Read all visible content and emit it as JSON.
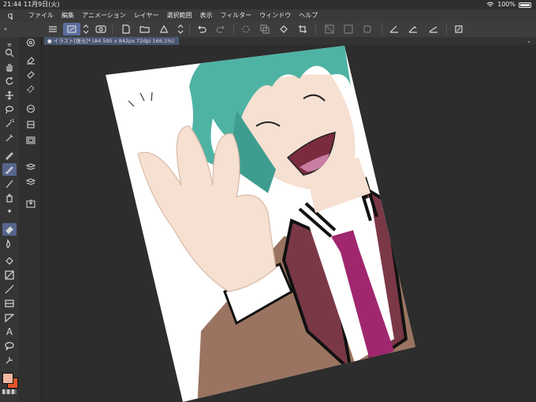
{
  "status": {
    "time": "21:44",
    "date": "11月9日(火)",
    "battery": "100%"
  },
  "menu": [
    "ファイル",
    "編集",
    "アニメーション",
    "レイヤー",
    "選択範囲",
    "表示",
    "フィルター",
    "ウィンドウ",
    "ヘルプ"
  ],
  "document_tab": {
    "label": "イラスト[復元]* (A4 595 x 842px 72dpi 166.1%)"
  },
  "colors": {
    "main": "#f2b8a2",
    "sub": "#e3542a",
    "hair": "#4fb3a4",
    "skin": "#f6e0d2",
    "tie": "#a0276e",
    "jacket": "#9a7460",
    "lapel": "#7a3846"
  },
  "tools": [
    "zoom-icon",
    "hand-icon",
    "rotate-icon",
    "move-icon",
    "lasso-select-icon",
    "magic-wand-icon",
    "eyedropper-icon",
    "pen-icon",
    "pencil-icon",
    "brush-icon",
    "airbrush-icon",
    "decoration-icon",
    "eraser-icon",
    "blend-icon",
    "fill-icon",
    "gradient-icon",
    "line-icon",
    "frame-icon",
    "ruler-icon",
    "text-icon",
    "balloon-icon",
    "correct-line-icon"
  ]
}
